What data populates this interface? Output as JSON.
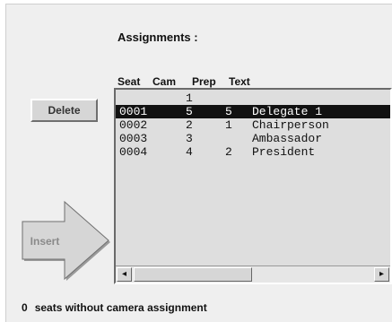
{
  "assignments_title": "Assignments :",
  "columns": [
    "Seat",
    "Cam",
    "Prep",
    "Text"
  ],
  "rows": [
    {
      "seat": "",
      "cam": "1",
      "prep": "",
      "text": ""
    },
    {
      "seat": "0001",
      "cam": "5",
      "prep": "5",
      "text": "Delegate 1",
      "selected": true
    },
    {
      "seat": "0002",
      "cam": "2",
      "prep": "1",
      "text": "Chairperson"
    },
    {
      "seat": "0003",
      "cam": "3",
      "prep": "",
      "text": "Ambassador"
    },
    {
      "seat": "0004",
      "cam": "4",
      "prep": "2",
      "text": "President"
    }
  ],
  "delete_label": "Delete",
  "insert_label": "Insert",
  "scroll_left_icon": "left-arrow",
  "scroll_right_icon": "right-arrow",
  "footer": {
    "count": "0",
    "text": "seats without camera assignment"
  }
}
